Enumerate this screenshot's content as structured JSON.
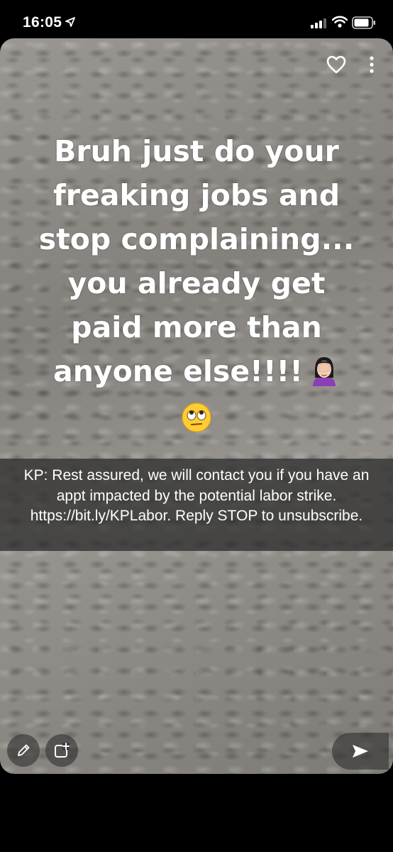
{
  "status_bar": {
    "time": "16:05"
  },
  "snap": {
    "caption_lines": [
      "Bruh just do your",
      "freaking jobs and",
      "stop complaining...",
      "you already get",
      "paid more than",
      "anyone else!!!!"
    ],
    "sms_text": "KP: Rest assured, we will contact you if you have an appt impacted by the potential labor strike. https://bit.ly/KPLabor. Reply STOP to unsubscribe."
  },
  "icons": {
    "status": [
      "location-arrow-icon",
      "cellular-signal-icon",
      "wifi-icon",
      "battery-icon"
    ],
    "top": [
      "heart-icon",
      "more-vertical-icon"
    ],
    "emoji": [
      "facepalm-woman-emoji",
      "eye-roll-emoji"
    ],
    "bottom": [
      "pencil-edit-icon",
      "add-to-story-icon",
      "send-arrow-icon"
    ]
  }
}
